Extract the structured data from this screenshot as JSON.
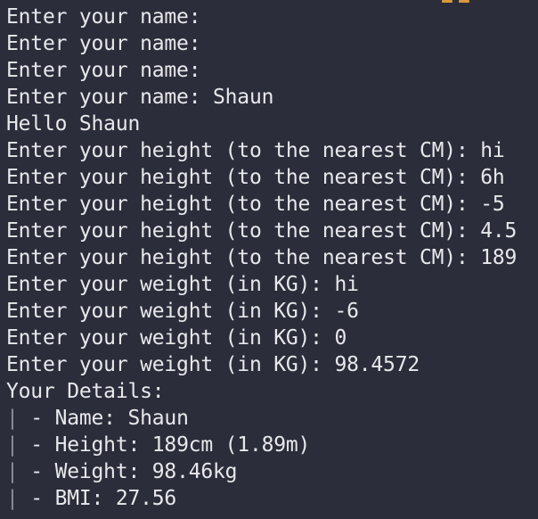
{
  "terminal": {
    "lines": [
      "Enter your name:",
      "Enter your name:",
      "Enter your name:",
      "Enter your name: Shaun",
      "Hello Shaun",
      "Enter your height (to the nearest CM): hi",
      "Enter your height (to the nearest CM): 6h",
      "Enter your height (to the nearest CM): -5",
      "Enter your height (to the nearest CM): 4.5",
      "Enter your height (to the nearest CM): 189",
      "Enter your weight (in KG): hi",
      "Enter your weight (in KG): -6",
      "Enter your weight (in KG): 0",
      "Enter your weight (in KG): 98.4572",
      "Your Details:"
    ],
    "details": {
      "bar": "|",
      "name": " - Name: Shaun",
      "height": " - Height: 189cm (1.89m)",
      "weight": " - Weight: 98.46kg",
      "bmi": " - BMI: 27.56"
    }
  },
  "colors": {
    "background": "#2b2d3a",
    "text": "#e8e8ec",
    "bar": "#8b8e9e",
    "accent": "#d99a3a"
  }
}
